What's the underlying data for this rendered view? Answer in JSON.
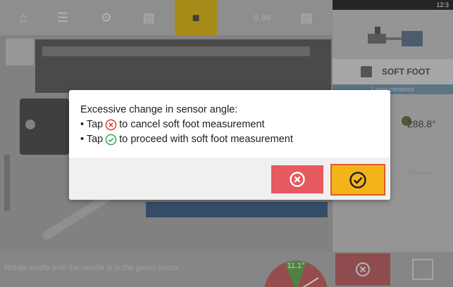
{
  "status_bar": {
    "time": "12:3"
  },
  "top_toolbar": {
    "dim_text": "0.00"
  },
  "right_panel": {
    "mode_label": "SOFT FOOT",
    "laser_status": "Laser centered",
    "reading": "288.8°",
    "faint_text": "Measure"
  },
  "bottom_bar": {
    "instruction": "Rotate shafts until the needle is in the green sector",
    "gauge_value": "11.1°"
  },
  "dialog": {
    "title": "Excessive change in sensor angle:",
    "line1_prefix": "• Tap",
    "line1_suffix": "to cancel soft foot measurement",
    "line2_prefix": "• Tap",
    "line2_suffix": "to proceed with soft foot measurement"
  },
  "icons": {
    "cancel": "cancel-x-circle-icon",
    "confirm": "confirm-check-circle-icon"
  },
  "colors": {
    "cancel_red": "#e5595f",
    "confirm_yellow": "#f3b41b",
    "confirm_border": "#e05a2a",
    "inline_red": "#d63a3a",
    "inline_green": "#3aa64a",
    "laser_bar": "#5f7a8f"
  }
}
